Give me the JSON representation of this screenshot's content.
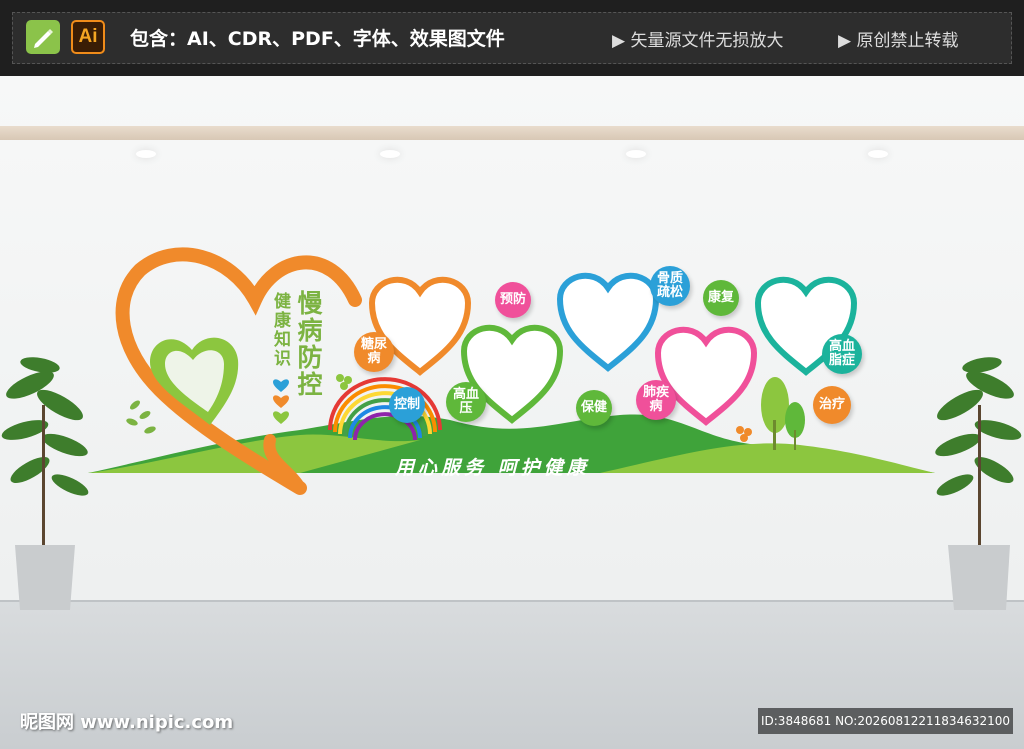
{
  "header": {
    "includes_text": "包含：AI、CDR、PDF、字体、效果图文件",
    "note_1": "▶ 矢量源文件无损放大",
    "note_2": "▶ 原创禁止转载",
    "ai_badge": "Ai"
  },
  "display": {
    "title_left": "健康知识",
    "title_main": "慢病防控",
    "slogan": "用心服务  呵护健康",
    "circles": [
      {
        "label": "糖尿病",
        "color": "#f08a2b"
      },
      {
        "label": "控制",
        "color": "#2ba0d8"
      },
      {
        "label": "高血压",
        "color": "#5fb83a"
      },
      {
        "label": "预防",
        "color": "#f0509a"
      },
      {
        "label": "保健",
        "color": "#5fb83a"
      },
      {
        "label": "骨质疏松",
        "color": "#2ba0d8"
      },
      {
        "label": "康复",
        "color": "#5fb83a"
      },
      {
        "label": "肺疾病",
        "color": "#f0509a"
      },
      {
        "label": "高血脂症",
        "color": "#1bb39c"
      },
      {
        "label": "治疗",
        "color": "#f08a2b"
      }
    ]
  },
  "watermark": {
    "site": "昵图网 www.nipic.com",
    "id_text": "ID:3848681 NO:20260812211834632100"
  },
  "colors": {
    "orange": "#f08a2b",
    "green": "#5fb83a",
    "blue": "#2ba0d8",
    "pink": "#f0509a",
    "teal": "#1bb39c"
  }
}
